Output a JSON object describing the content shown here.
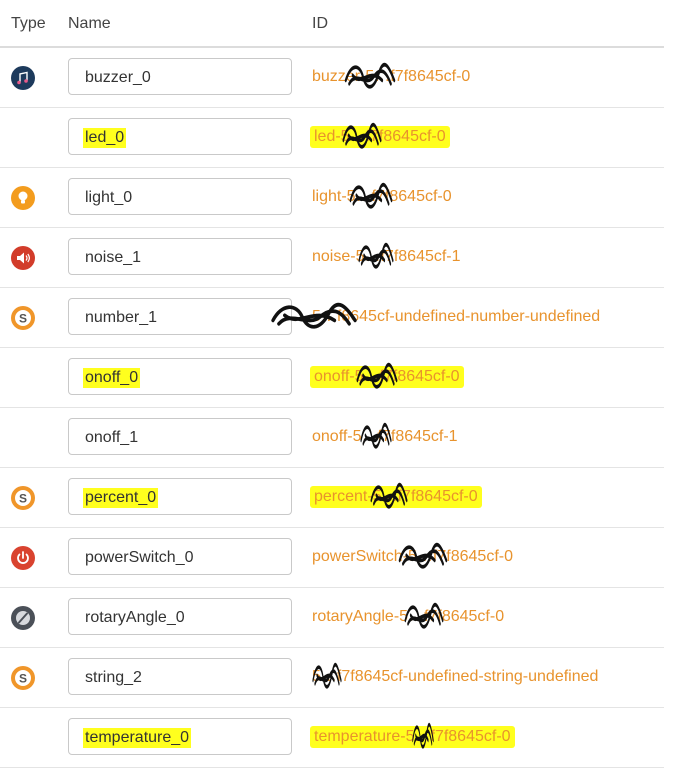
{
  "headers": {
    "type": "Type",
    "name": "Name",
    "id": "ID"
  },
  "rows": [
    {
      "name": "buzzer_0",
      "id": "buzzer-5…f7f8645cf-0",
      "icon": "music-note-icon",
      "icon_bg": "#1d3a5c",
      "highlight": false
    },
    {
      "name": "led_0",
      "id": "led-5…f7f8645cf-0",
      "icon": "",
      "icon_bg": "",
      "highlight": true
    },
    {
      "name": "light_0",
      "id": "light-5…f7f8645cf-0",
      "icon": "lightbulb-icon",
      "icon_bg": "#f39c1e",
      "highlight": false
    },
    {
      "name": "noise_1",
      "id": "noise-5…f7f8645cf-1",
      "icon": "speaker-icon",
      "icon_bg": "#d23c2a",
      "highlight": false
    },
    {
      "name": "number_1",
      "id": "5…f8645cf-undefined-number-undefined",
      "icon": "coin-s-icon",
      "icon_bg": "#f0962a",
      "highlight": false
    },
    {
      "name": "onoff_0",
      "id": "onoff-5…f7f8645cf-0",
      "icon": "",
      "icon_bg": "",
      "highlight": true
    },
    {
      "name": "onoff_1",
      "id": "onoff-5…f7f8645cf-1",
      "icon": "",
      "icon_bg": "",
      "highlight": false
    },
    {
      "name": "percent_0",
      "id": "percent-5…f7f8645cf-0",
      "icon": "coin-s-icon",
      "icon_bg": "#f0962a",
      "highlight": true
    },
    {
      "name": "powerSwitch_0",
      "id": "powerSwitch-5…f7f8645cf-0",
      "icon": "power-icon",
      "icon_bg": "#d9432f",
      "highlight": false
    },
    {
      "name": "rotaryAngle_0",
      "id": "rotaryAngle-5…f7f8645cf-0",
      "icon": "rotary-knob-icon",
      "icon_bg": "#4b5058",
      "highlight": false
    },
    {
      "name": "string_2",
      "id": "5…f7f8645cf-undefined-string-undefined",
      "icon": "coin-s-icon",
      "icon_bg": "#f0962a",
      "highlight": false
    },
    {
      "name": "temperature_0",
      "id": "temperature-5…f7f8645cf-0",
      "icon": "",
      "icon_bg": "",
      "highlight": true
    }
  ]
}
